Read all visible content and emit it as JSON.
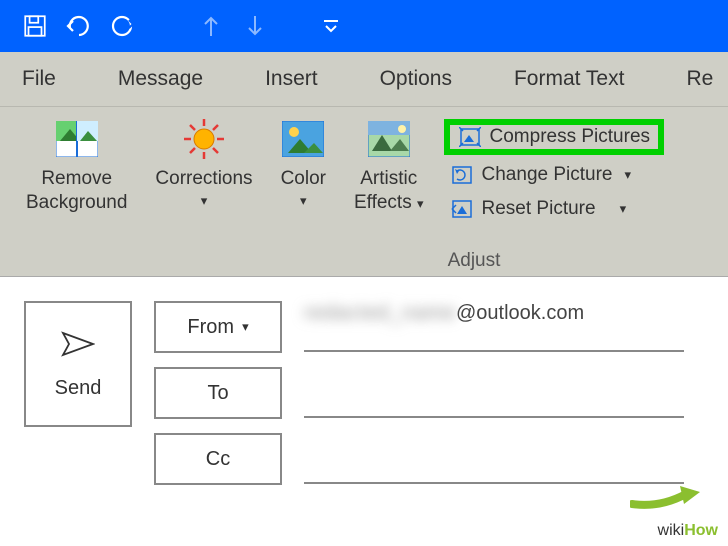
{
  "titleBar": {
    "qat": [
      "save-icon",
      "undo-icon",
      "redo-icon",
      "up-arrow-icon",
      "down-arrow-icon",
      "customize-icon"
    ]
  },
  "tabs": {
    "file": "File",
    "message": "Message",
    "insert": "Insert",
    "options": "Options",
    "formatText": "Format Text",
    "review": "Re"
  },
  "ribbon": {
    "removeBg1": "Remove",
    "removeBg2": "Background",
    "corrections": "Corrections",
    "color": "Color",
    "artistic1": "Artistic",
    "artistic2": "Effects",
    "compress": "Compress Pictures",
    "changePic": "Change Picture",
    "resetPic": "Reset Picture",
    "groupLabel": "Adjust"
  },
  "compose": {
    "send": "Send",
    "from": "From",
    "to": "To",
    "cc": "Cc",
    "emailVisible": "@outlook.com",
    "emailHidden": "redacted_name"
  },
  "watermark": {
    "wiki": "wiki",
    "how": "How"
  }
}
